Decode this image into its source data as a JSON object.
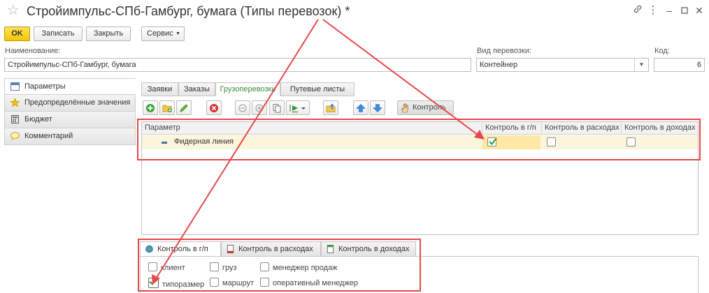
{
  "window": {
    "title": "Стройимпульс-СПб-Гамбург, бумага (Типы перевозок) *",
    "icons": [
      "star-icon",
      "link-icon",
      "more-icon",
      "minimize-icon",
      "maximize-icon",
      "close-icon"
    ]
  },
  "toolbar": {
    "ok_label": "OK",
    "save_label": "Записать",
    "close_label": "Закрыть",
    "service_label": "Сервис"
  },
  "form": {
    "name_label": "Наименование:",
    "name_value": "Стройимпульс-СПб-Гамбург, бумага",
    "transport_label": "Вид перевозки:",
    "transport_value": "Контейнер",
    "code_label": "Код:",
    "code_value": "6"
  },
  "nav": {
    "items": [
      {
        "label": "Параметры",
        "icon": "parameters-icon",
        "active": true
      },
      {
        "label": "Предопределённые значения",
        "icon": "star-icon",
        "active": false
      },
      {
        "label": "Бюджет",
        "icon": "calculator-icon",
        "active": false
      },
      {
        "label": "Комментарий",
        "icon": "comment-icon",
        "active": false
      }
    ]
  },
  "inner_tabs": [
    {
      "label": "Заявки",
      "active": false
    },
    {
      "label": "Заказы",
      "active": false
    },
    {
      "label": "Грузоперевозки",
      "active": true
    },
    {
      "label": "Путевые листы",
      "active": false
    }
  ],
  "table_toolbar": {
    "control_label": "Контроль",
    "buttons": [
      "add-icon",
      "add-folder-icon",
      "edit-icon",
      "delete-icon",
      "collapse-icon",
      "expand-icon",
      "copy-icon",
      "play-dropdown-icon",
      "folder-up-icon",
      "arrow-up-icon",
      "arrow-down-icon",
      "hand-icon"
    ]
  },
  "table": {
    "columns": [
      "Параметр",
      "Контроль в г/п",
      "Контроль в расходах",
      "Контроль в доходах"
    ],
    "rows": [
      {
        "param": "Фидерная линия",
        "gp": true,
        "expenses": false,
        "income": false
      }
    ]
  },
  "bottom_tabs": [
    {
      "label": "Контроль в г/п",
      "icon": "globe-icon",
      "active": true
    },
    {
      "label": "Контроль в расходах",
      "icon": "document-red-icon",
      "active": false
    },
    {
      "label": "Контроль в доходах",
      "icon": "document-green-icon",
      "active": false
    }
  ],
  "bottom_checkboxes": [
    {
      "label": "клиент",
      "checked": false
    },
    {
      "label": "груз",
      "checked": false
    },
    {
      "label": "менеджер продаж",
      "checked": false
    },
    {
      "label": "типоразмер",
      "checked": true
    },
    {
      "label": "маршрут",
      "checked": false
    },
    {
      "label": "оперативный менеджер",
      "checked": false
    }
  ],
  "colors": {
    "accent_yellow": "#f5c600",
    "annotation_red": "#e8474a",
    "active_tab_green": "#3b8a3b",
    "row_highlight": "#fbf5dc"
  }
}
